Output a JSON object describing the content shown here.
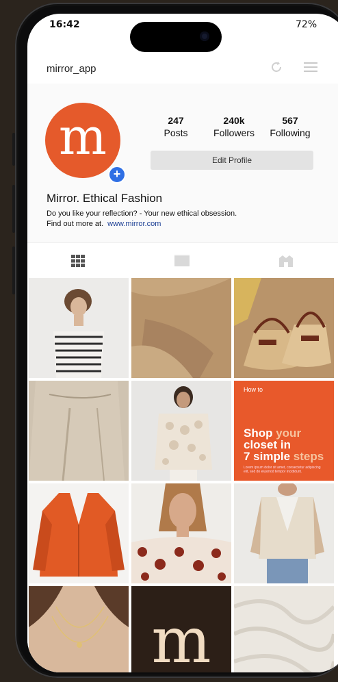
{
  "status_bar": {
    "time": "16:42",
    "battery": "72%"
  },
  "app_bar": {
    "title": "mirror_app",
    "icons": [
      "refresh-icon",
      "menu-icon"
    ]
  },
  "profile": {
    "avatar_letter": "m",
    "add_badge": "+",
    "stats": [
      {
        "value": "247",
        "label": "Posts"
      },
      {
        "value": "240k",
        "label": "Followers"
      },
      {
        "value": "567",
        "label": "Following"
      }
    ],
    "edit_button": "Edit Profile",
    "name": "Mirror. Ethical Fashion",
    "bio_line1": "Do you like your reflection? - Your new ethical obsession.",
    "bio_line2": "Find out more at.",
    "link": "www.mirror.com"
  },
  "tabs": [
    "grid-icon",
    "feed-icon",
    "tagged-icon"
  ],
  "grid": {
    "posts": [
      {
        "name": "post-woman-striped-top"
      },
      {
        "name": "post-beige-sleeve"
      },
      {
        "name": "post-straw-bags"
      },
      {
        "name": "post-beige-trousers"
      },
      {
        "name": "post-crochet-cardigan"
      },
      {
        "name": "post-promo"
      },
      {
        "name": "post-orange-blazer"
      },
      {
        "name": "post-floral-blouse"
      },
      {
        "name": "post-beige-vest"
      },
      {
        "name": "post-necklace"
      },
      {
        "name": "post-logo"
      },
      {
        "name": "post-linen-fabric"
      }
    ],
    "promo": {
      "small": "How to",
      "line1_a": "Shop ",
      "line1_b": "your",
      "line2": "closet in",
      "line3_a": "7 simple ",
      "line3_b": "steps",
      "fine": "Lorem ipsum dolor sit amet, consectetur adipiscing elit, sed do eiusmod tempor incididunt."
    },
    "logo_letter": "m"
  },
  "colors": {
    "brand": "#e55a2b",
    "badge": "#2f6fe4",
    "link": "#1c3f94"
  }
}
